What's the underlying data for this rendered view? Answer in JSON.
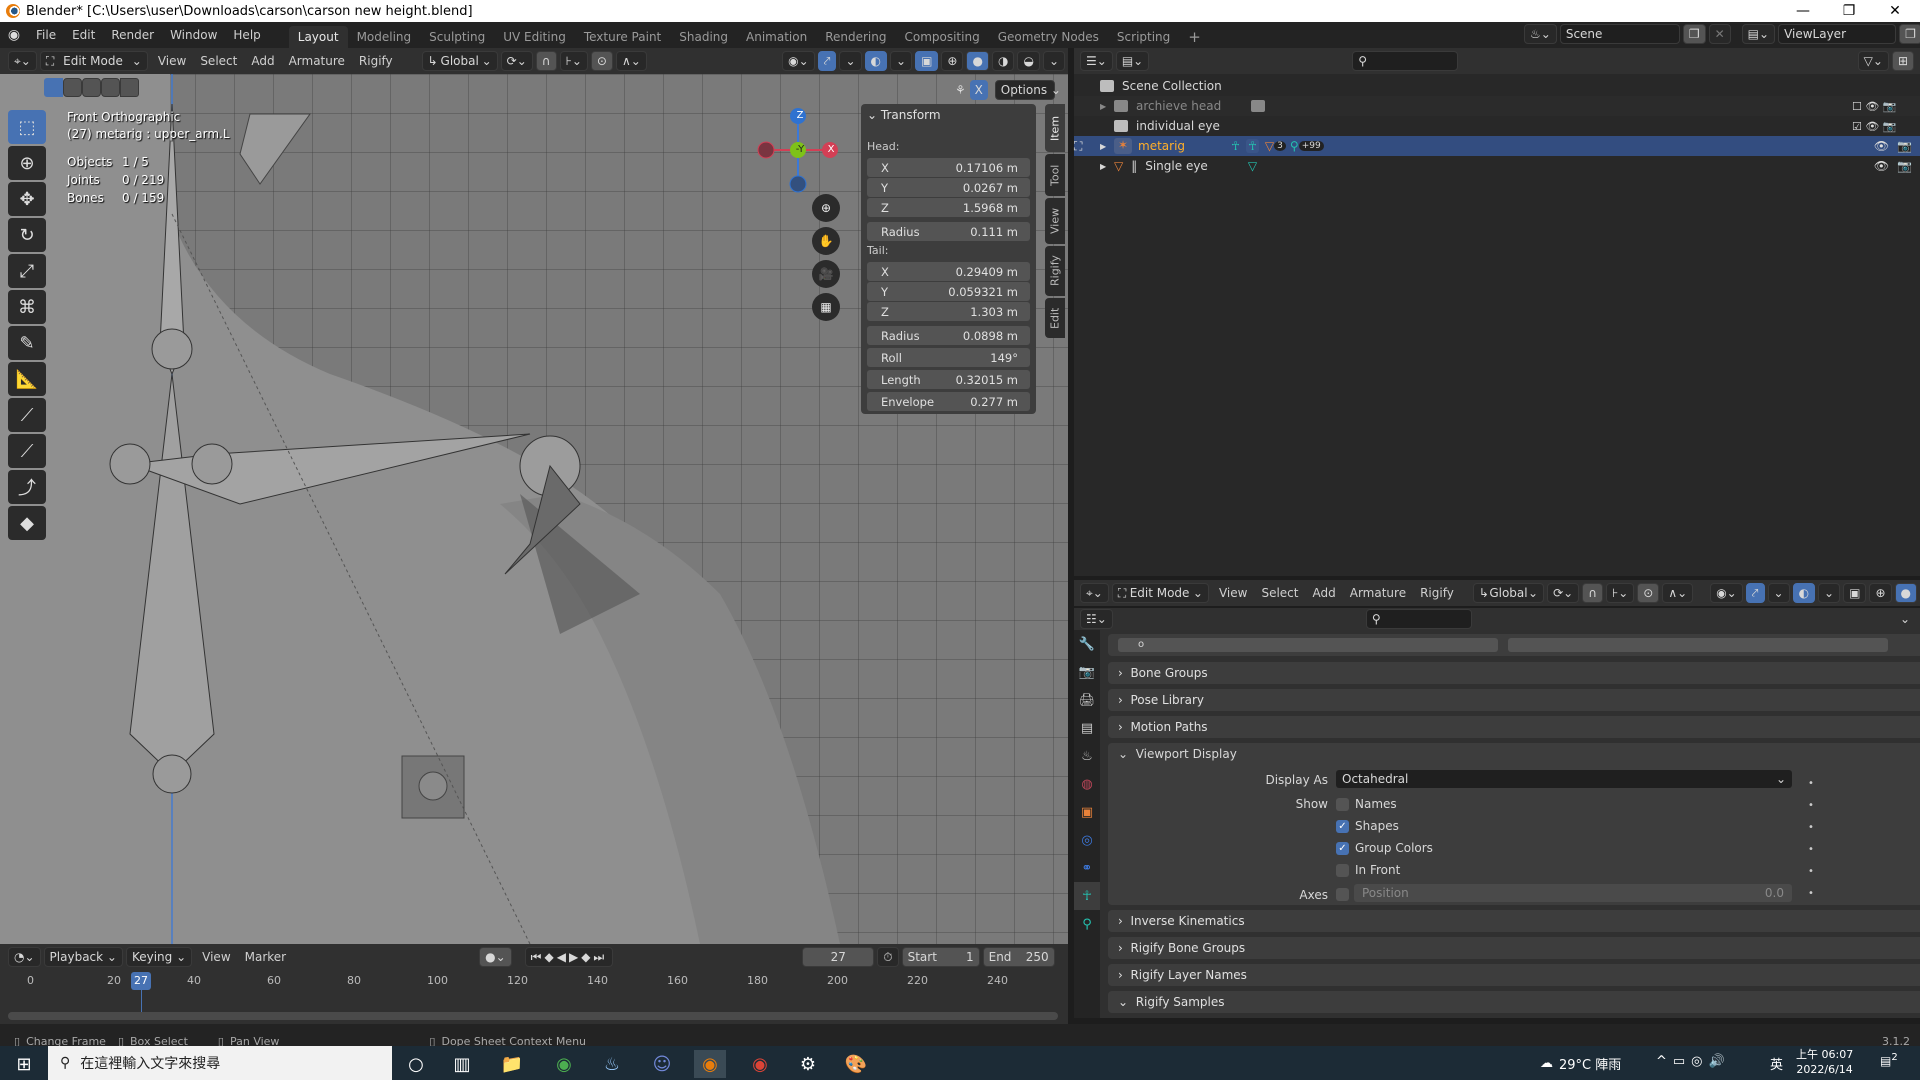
{
  "window": {
    "title": "Blender* [C:\\Users\\user\\Downloads\\carson\\carson new height.blend]",
    "controls": {
      "minimize": "—",
      "maximize": "❐",
      "close": "✕"
    }
  },
  "menubar": {
    "menus": [
      "File",
      "Edit",
      "Render",
      "Window",
      "Help"
    ],
    "workspace_tabs": [
      "Layout",
      "Modeling",
      "Sculpting",
      "UV Editing",
      "Texture Paint",
      "Shading",
      "Animation",
      "Rendering",
      "Compositing",
      "Geometry Nodes",
      "Scripting"
    ],
    "active_tab": "Layout",
    "add_tab": "+",
    "scene": "Scene",
    "view_layer": "ViewLayer"
  },
  "viewport_header": {
    "mode": "Edit Mode",
    "menus": [
      "View",
      "Select",
      "Add",
      "Armature",
      "Rigify"
    ],
    "orientation": "Global",
    "options_label": "Options",
    "xmirror_label": "X"
  },
  "viewport_overlay": {
    "view_name": "Front Orthographic",
    "object_info": "(27) metarig : upper_arm.L",
    "stats": [
      {
        "label": "Objects",
        "value": "1 / 5"
      },
      {
        "label": "Joints",
        "value": "0 / 219"
      },
      {
        "label": "Bones",
        "value": "0 / 159"
      }
    ],
    "gizmo": {
      "z": "Z",
      "y": "-Y",
      "x": "X"
    }
  },
  "transform_panel": {
    "title": "Transform",
    "head_label": "Head:",
    "head": [
      {
        "label": "X",
        "value": "0.17106 m"
      },
      {
        "label": "Y",
        "value": "0.0267 m"
      },
      {
        "label": "Z",
        "value": "1.5968 m"
      }
    ],
    "head_radius": {
      "label": "Radius",
      "value": "0.111 m"
    },
    "tail_label": "Tail:",
    "tail": [
      {
        "label": "X",
        "value": "0.29409 m"
      },
      {
        "label": "Y",
        "value": "0.059321 m"
      },
      {
        "label": "Z",
        "value": "1.303 m"
      }
    ],
    "tail_radius": {
      "label": "Radius",
      "value": "0.0898 m"
    },
    "roll": {
      "label": "Roll",
      "value": "149°"
    },
    "length": {
      "label": "Length",
      "value": "0.32015 m"
    },
    "envelope": {
      "label": "Envelope",
      "value": "0.277 m"
    }
  },
  "sidebar_tabs": [
    "Item",
    "Tool",
    "View",
    "Rigify",
    "Edit"
  ],
  "outliner": {
    "root": "Scene Collection",
    "items": [
      {
        "name": "archieve head",
        "type": "collection",
        "excluded": true
      },
      {
        "name": "individual eye",
        "type": "collection"
      },
      {
        "name": "metarig",
        "type": "armature",
        "selected": true,
        "badge1": "3",
        "badge2": "+99"
      },
      {
        "name": "Single eye",
        "type": "mesh"
      }
    ]
  },
  "properties": {
    "header_mode": "Edit Mode",
    "header_menus": [
      "View",
      "Select",
      "Add",
      "Armature",
      "Rigify"
    ],
    "header_orientation": "Global",
    "layer_dot": "o",
    "panels": [
      "Bone Groups",
      "Pose Library",
      "Motion Paths"
    ],
    "viewport_display": {
      "title": "Viewport Display",
      "display_as_label": "Display As",
      "display_as_value": "Octahedral",
      "show_label": "Show",
      "options": [
        {
          "label": "Names",
          "checked": false
        },
        {
          "label": "Shapes",
          "checked": true
        },
        {
          "label": "Group Colors",
          "checked": true
        },
        {
          "label": "In Front",
          "checked": false
        }
      ],
      "axes_label": "Axes",
      "axes_position_label": "Position",
      "axes_position_value": "0.0"
    },
    "panels_after": [
      "Inverse Kinematics",
      "Rigify Bone Groups",
      "Rigify Layer Names",
      "Rigify Samples"
    ]
  },
  "timeline": {
    "menus": [
      "Playback",
      "Keying",
      "View",
      "Marker"
    ],
    "current_frame": "27",
    "start_label": "Start",
    "start": "1",
    "end_label": "End",
    "end": "250",
    "ticks": [
      "0",
      "20",
      "40",
      "60",
      "80",
      "100",
      "120",
      "140",
      "160",
      "180",
      "200",
      "220",
      "240"
    ],
    "playhead": "27"
  },
  "statusbar": {
    "hints": [
      "Change Frame",
      "Box Select",
      "Pan View",
      "Dope Sheet Context Menu"
    ],
    "version": "3.1.2"
  },
  "taskbar": {
    "search_placeholder": "在這裡輸入文字來搜尋",
    "weather": "29°C 陣雨",
    "ime": "英",
    "time": "上午 06:07",
    "date": "2022/6/14",
    "notifications": "2"
  }
}
